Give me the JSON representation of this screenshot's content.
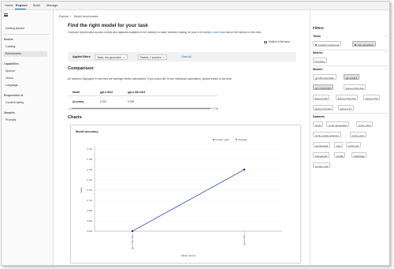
{
  "topnav": {
    "tabs": [
      "Home",
      "Explore",
      "Build",
      "Manage"
    ],
    "active": "Explore"
  },
  "breadcrumb": {
    "items": [
      "Explore",
      "Model benchmarks"
    ],
    "separator": "/"
  },
  "sidebar": {
    "items": [
      {
        "label": "Getting started"
      },
      {
        "section": "Models"
      },
      {
        "label": "Catalog"
      },
      {
        "label": "Benchmarks",
        "active": true
      },
      {
        "section": "Capabilities"
      },
      {
        "label": "Speech"
      },
      {
        "label": "Vision"
      },
      {
        "label": "Language"
      },
      {
        "section": "Responsible AI"
      },
      {
        "label": "Content safety"
      },
      {
        "section": "Samples"
      },
      {
        "label": "Prompts"
      }
    ]
  },
  "main": {
    "title": "Find the right model for your task",
    "description": "Compare benchmarks across models and datasets available in the industry to make decision making for your LLM needs.",
    "learn_more": "Learn more",
    "description_tail": "about the metrics in this view.",
    "switch_label": "Switch to list view",
    "applied_filters": {
      "label": "Applied filters",
      "chips": [
        "Tasks: text generation",
        "Models: 2 selected"
      ],
      "clear": "Clear all"
    },
    "comparison": {
      "title": "Comparison",
      "note": "All numbers displayed in overview are average metric calculations. If you would like to see individual calculations, please switch to list view.",
      "header": [
        "Model",
        "gpt-4-0314",
        "gpt-4-32k-0314"
      ],
      "rows": [
        [
          "Accuracy",
          "0.702",
          "0.705"
        ]
      ]
    },
    "charts_title": "Charts"
  },
  "chart_data": {
    "type": "line",
    "title": "Model accuracy",
    "categories": [
      "gpt-4-32k-0314",
      "gpt-4-0314"
    ],
    "series": [
      {
        "name": "human_eval",
        "values": [
          0.694,
          0.706
        ]
      }
    ],
    "legend_entries": [
      "human_eval",
      "Average"
    ],
    "xlabel": "Model names",
    "ylabel": "Value",
    "yticks": [
      "0.694",
      "0.696",
      "0.698",
      "0.700",
      "0.702",
      "0.704",
      "0.706",
      "0.708",
      "0.710"
    ],
    "ylim": [
      0.694,
      0.71
    ],
    "colors": {
      "line": "#3b5ba9",
      "point": "#1a237e"
    }
  },
  "filters_panel": {
    "title": "Filters",
    "sections": [
      {
        "name": "Tasks",
        "tags": [
          {
            "label": "Question answering",
            "selected": false,
            "icon": "qa-icon"
          },
          {
            "label": "Text generation",
            "selected": true,
            "icon": "text-icon"
          }
        ]
      },
      {
        "name": "Metrics",
        "tags": [
          {
            "label": "Accuracy",
            "selected": false
          }
        ]
      },
      {
        "name": "Models",
        "tags": [
          {
            "label": "gpt-35-turbo-0301",
            "selected": false
          },
          {
            "label": "gpt-4-0314",
            "selected": true
          },
          {
            "label": "gpt-4-32k-0314",
            "selected": true
          },
          {
            "label": "llama-2-13b-chat",
            "selected": false
          },
          {
            "label": "llama-2-13b",
            "selected": false
          },
          {
            "label": "llama-2-70b-chat",
            "selected": false
          },
          {
            "label": "llama-2-70b",
            "selected": false
          },
          {
            "label": "llama-2-7b-chat",
            "selected": false
          },
          {
            "label": "llama-2-7b",
            "selected": false
          }
        ]
      },
      {
        "name": "Datasets",
        "tags": [
          {
            "label": "boolq"
          },
          {
            "label": "mmlu_humanities"
          },
          {
            "label": "mmlu_other"
          },
          {
            "label": "mmlu_social_sciences"
          },
          {
            "label": "mmlu_stem"
          },
          {
            "label": "openbookqa"
          },
          {
            "label": "piqa"
          },
          {
            "label": "social_iqa"
          },
          {
            "label": "winogrande"
          },
          {
            "label": "gsm8k"
          },
          {
            "label": "hellaswag"
          },
          {
            "label": "human_eval"
          }
        ]
      }
    ]
  }
}
